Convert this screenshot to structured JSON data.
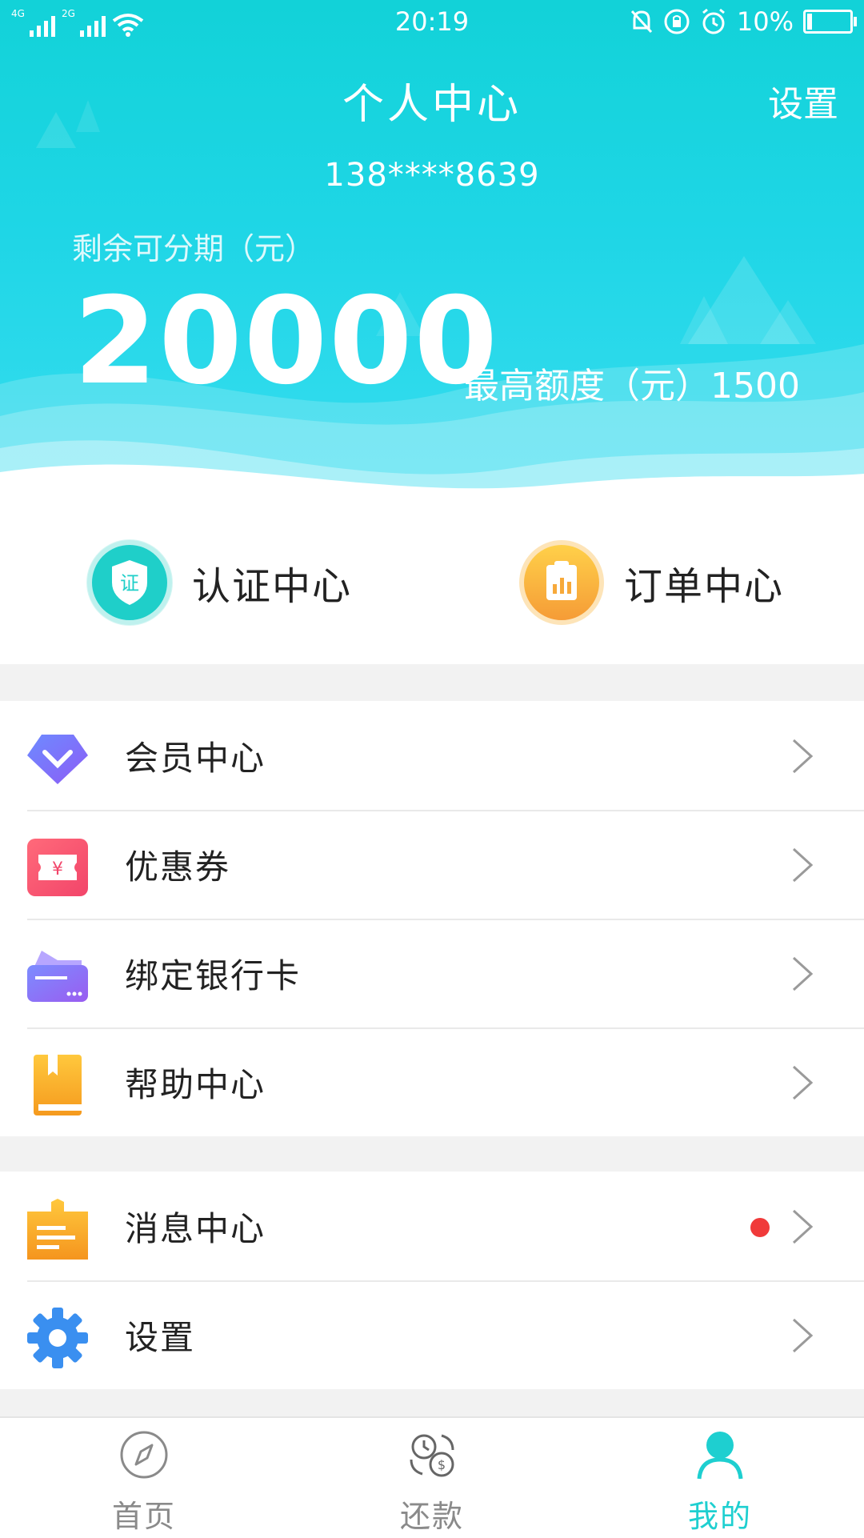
{
  "status_bar": {
    "network_1": "4G",
    "network_2": "2G",
    "time": "20:19",
    "battery": "10%"
  },
  "header": {
    "title": "个人中心",
    "settings_label": "设置",
    "phone": "138****8639",
    "remain_label": "剩余可分期（元）",
    "remain_amount": "20000",
    "max_limit": "最高额度（元）1500"
  },
  "quick_actions": [
    {
      "label": "认证中心",
      "icon": "shield-cert-icon",
      "badge_text": "证",
      "color": "#1fcfc9"
    },
    {
      "label": "订单中心",
      "icon": "clipboard-chart-icon",
      "color": "#f7a93a"
    }
  ],
  "menu_group_1": [
    {
      "label": "会员中心",
      "icon": "diamond-icon"
    },
    {
      "label": "优惠券",
      "icon": "coupon-icon",
      "symbol": "¥"
    },
    {
      "label": "绑定银行卡",
      "icon": "bank-card-icon"
    },
    {
      "label": "帮助中心",
      "icon": "book-icon"
    }
  ],
  "menu_group_2": [
    {
      "label": "消息中心",
      "icon": "message-icon",
      "has_unread_dot": true
    },
    {
      "label": "设置",
      "icon": "gear-icon"
    }
  ],
  "tabbar": [
    {
      "label": "首页",
      "icon": "compass-icon",
      "active": false
    },
    {
      "label": "还款",
      "icon": "repay-clock-icon",
      "active": false
    },
    {
      "label": "我的",
      "icon": "user-icon",
      "active": true
    }
  ],
  "colors": {
    "accent": "#1ecfd0",
    "inactive": "#8a8a8a",
    "unread_dot": "#f03a3a"
  }
}
